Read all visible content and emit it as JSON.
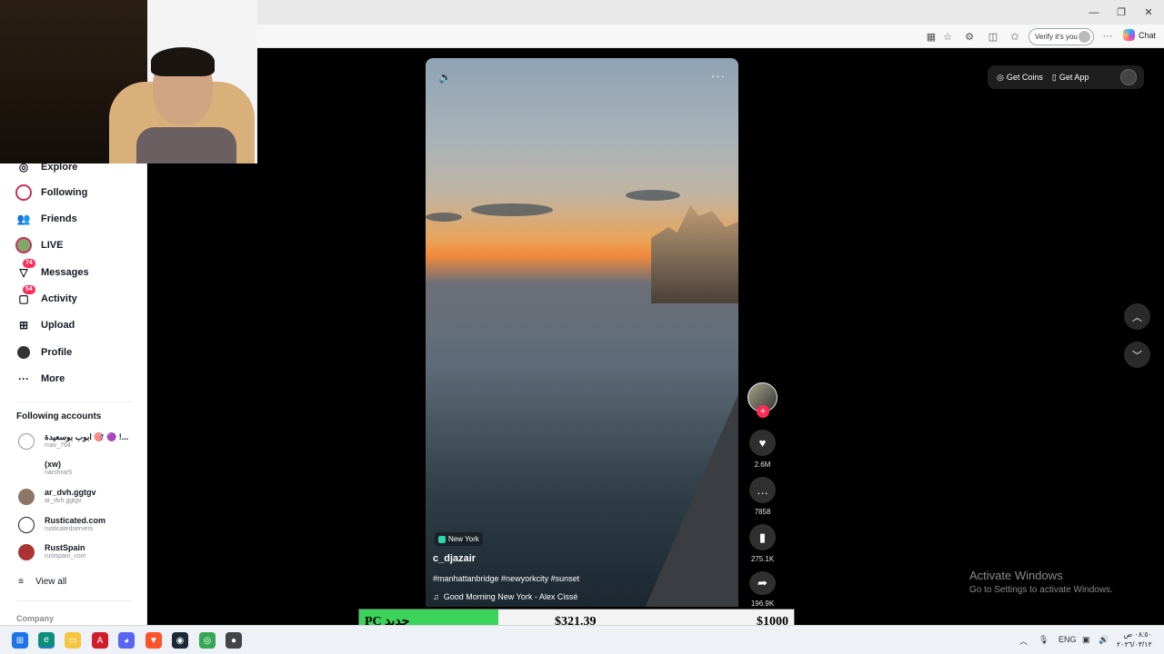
{
  "browser": {
    "verify_label": "Verify it's you",
    "chat_label": "Chat",
    "window_controls": [
      "minimize",
      "restore",
      "close"
    ]
  },
  "sidebar": {
    "items": [
      {
        "label": "Explore",
        "icon": "compass-icon"
      },
      {
        "label": "Following",
        "icon": "following-icon"
      },
      {
        "label": "Friends",
        "icon": "friends-icon"
      },
      {
        "label": "LIVE",
        "icon": "live-icon"
      },
      {
        "label": "Messages",
        "icon": "messages-icon",
        "badge": "74"
      },
      {
        "label": "Activity",
        "icon": "activity-icon",
        "badge": "54"
      },
      {
        "label": "Upload",
        "icon": "upload-icon"
      },
      {
        "label": "Profile",
        "icon": "profile-icon"
      },
      {
        "label": "More",
        "icon": "more-icon"
      }
    ],
    "following_title": "Following accounts",
    "accounts": [
      {
        "name": "ابوب بوسعيدة 🎯 🟣 !...",
        "handle": "mav_764"
      },
      {
        "name": "(xw)",
        "handle": "narshrar5"
      },
      {
        "name": "ar_dvh.ggtgv",
        "handle": "ar_dvh.ggtgv"
      },
      {
        "name": "Rusticated.com",
        "handle": "rusticatedservers"
      },
      {
        "name": "RustSpain",
        "handle": "rustspain_com"
      }
    ],
    "view_all": "View all",
    "footer_section": "Company"
  },
  "video": {
    "location": "New York",
    "author": "c_djazair",
    "hashtags": "#manhattanbridge #newyorkcity #sunset",
    "music": "Good Morning New York - Alex Cissé"
  },
  "actions": {
    "likes": "2.6M",
    "comments": "7858",
    "saves": "275.1K",
    "shares": "196.9K"
  },
  "top_right": {
    "get_coins": "Get Coins",
    "get_app": "Get App"
  },
  "windows_notice": {
    "title": "Activate Windows",
    "subtitle": "Go to Settings to activate Windows."
  },
  "donation": {
    "label": "PC جديد",
    "current": "$321.39",
    "goal": "$1000",
    "progress_fraction": 0.321,
    "fill_color": "#3bd35a"
  },
  "taskbar": {
    "language": "ENG",
    "time": "٠٨:٥٠ ص",
    "date": "٢٠٢٦/٠٣/١٢"
  }
}
